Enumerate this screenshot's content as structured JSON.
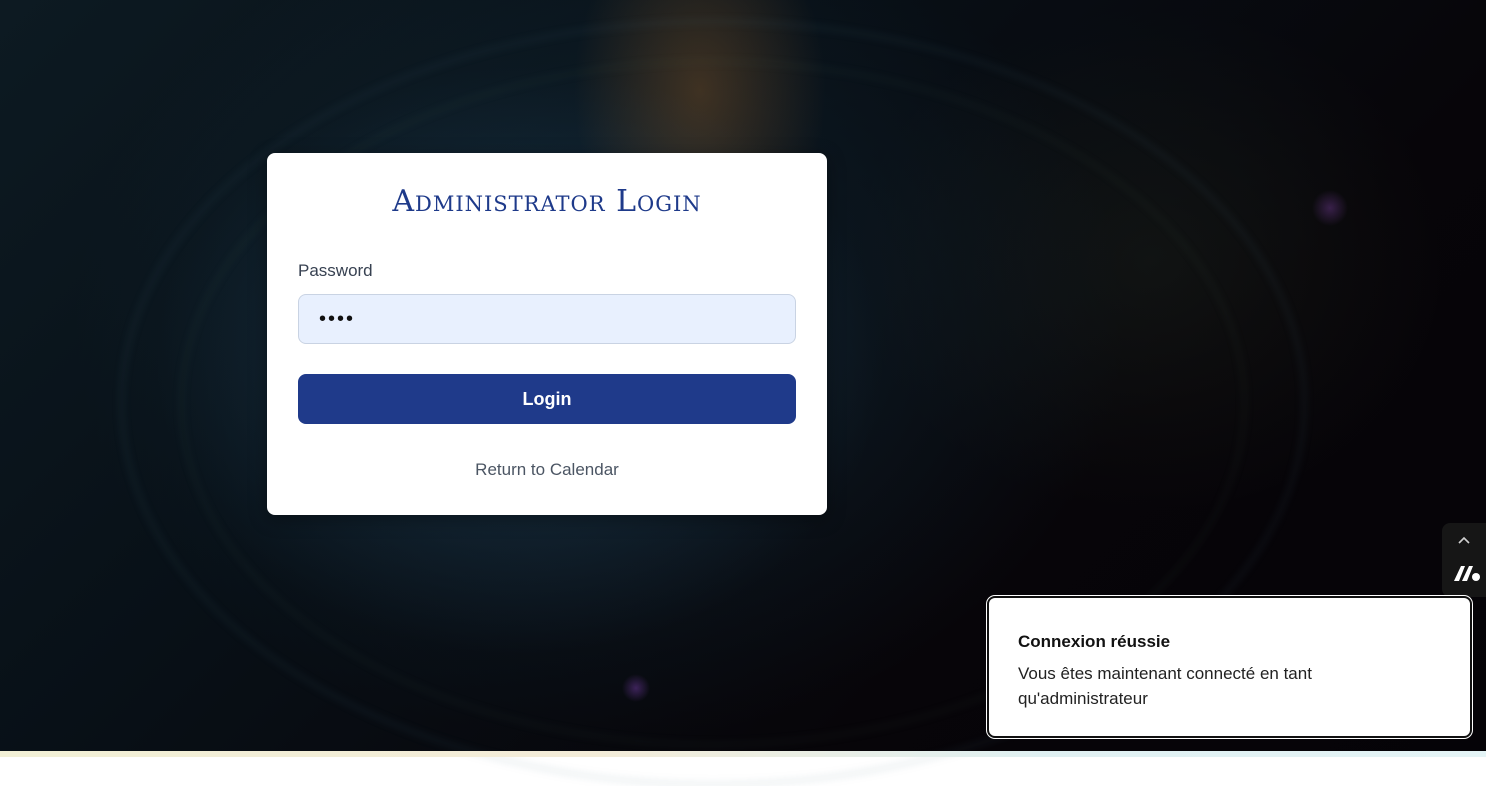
{
  "login_card": {
    "title": "Administrator Login",
    "password_label": "Password",
    "password_value": "••••",
    "login_button": "Login",
    "return_link": "Return to Calendar"
  },
  "side_widget": {
    "chevron_icon": "chevron-up-icon",
    "logo_icon": "m-logo-icon"
  },
  "toast": {
    "title": "Connexion réussie",
    "message": "Vous êtes maintenant connecté en tant qu'administrateur"
  },
  "colors": {
    "accent": "#1f3a8a",
    "title": "#1e3a8a",
    "input_bg": "#e8f0fe"
  }
}
